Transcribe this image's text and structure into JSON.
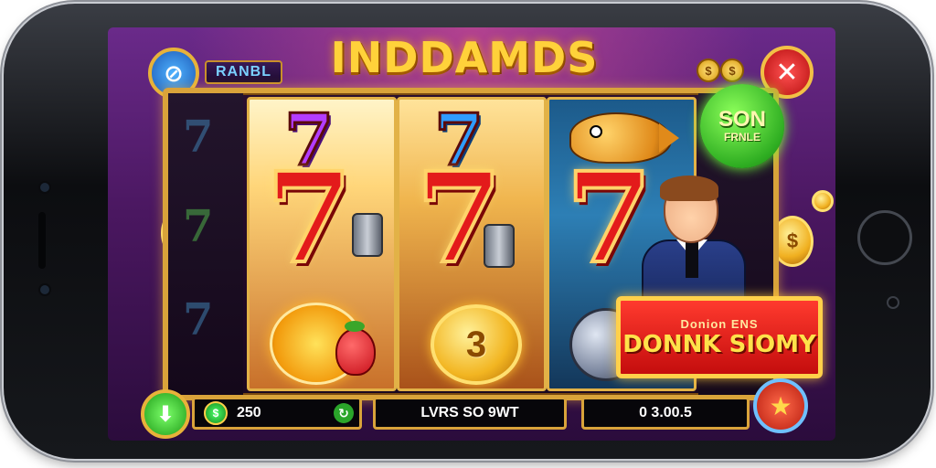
{
  "game": {
    "title": "INDDAMDS",
    "panel_label": "RANBL"
  },
  "header": {
    "menu_icon": "slash-circle-icon",
    "close_icon": "close-icon",
    "close_symbol": "✕",
    "coin_symbol": "$"
  },
  "badge": {
    "line1": "SON",
    "line2": "FRNLE"
  },
  "reels": [
    {
      "top_symbol": "7",
      "middle_symbol": "7",
      "bottom_symbol": "sun-strawberry"
    },
    {
      "top_symbol": "7",
      "middle_symbol": "7",
      "bottom_symbol": "3"
    },
    {
      "top_symbol": "fish",
      "middle_symbol": "7",
      "bottom_symbol": "orb"
    }
  ],
  "win_banner": {
    "subtitle": "Donion ENS",
    "title": "DONNK SIOMY"
  },
  "bottom_bar": {
    "balance": "250",
    "message": "LVRS SO 9WT",
    "win_amount": "0 3.00.5"
  },
  "colors": {
    "accent_gold": "#d9a33a",
    "win_red": "#c40d0d",
    "badge_green": "#2fae22"
  }
}
